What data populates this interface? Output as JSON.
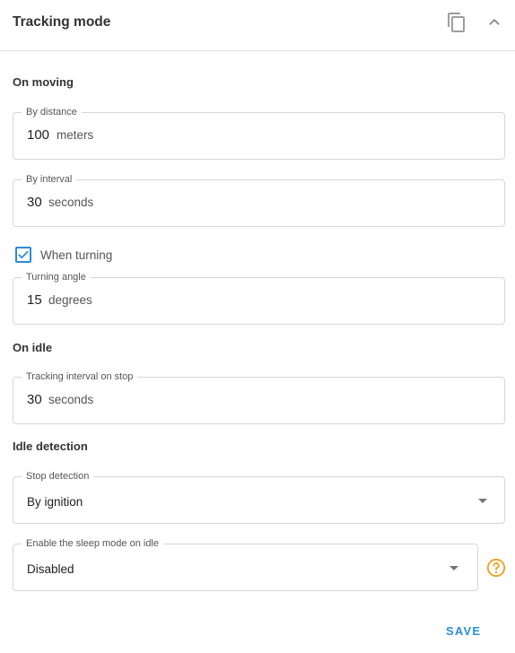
{
  "header": {
    "title": "Tracking mode",
    "copy_icon": "copy-icon",
    "collapse_icon": "chevron-up-icon"
  },
  "on_moving": {
    "label": "On moving",
    "by_distance": {
      "label": "By distance",
      "value": "100",
      "unit": "meters"
    },
    "by_interval": {
      "label": "By interval",
      "value": "30",
      "unit": "seconds"
    },
    "when_turning": {
      "label": "When turning",
      "checked": true
    },
    "turning_angle": {
      "label": "Turning angle",
      "value": "15",
      "unit": "degrees"
    }
  },
  "on_idle": {
    "label": "On idle",
    "tracking_interval": {
      "label": "Tracking interval on stop",
      "value": "30",
      "unit": "seconds"
    }
  },
  "idle_detection": {
    "label": "Idle detection",
    "stop_detection": {
      "label": "Stop detection",
      "value": "By ignition"
    },
    "sleep_mode": {
      "label": "Enable the sleep mode on idle",
      "value": "Disabled"
    },
    "help_icon": "help-circle-icon"
  },
  "footer": {
    "save_label": "SAVE"
  },
  "colors": {
    "accent": "#2a8dd6",
    "checkbox": "#2e8bd8",
    "help": "#f0a020",
    "border": "#d6d6d6"
  }
}
